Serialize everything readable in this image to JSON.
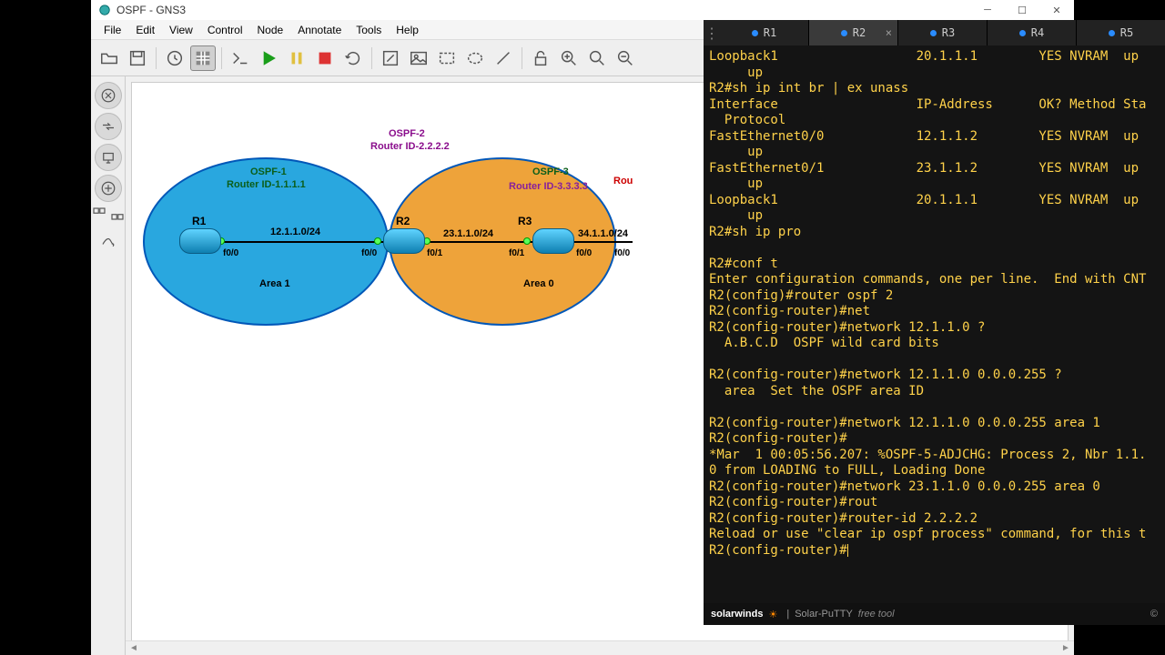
{
  "window": {
    "title": "OSPF - GNS3"
  },
  "menu": [
    "File",
    "Edit",
    "View",
    "Control",
    "Node",
    "Annotate",
    "Tools",
    "Help"
  ],
  "canvas": {
    "areas": [
      {
        "name": "Area 1",
        "ospf": "OSPF-1",
        "router_id": "Router ID-1.1.1.1",
        "ospf_color": "#0b5e1a",
        "id_color": "#0b5e1a"
      },
      {
        "name": "Area 0",
        "ospf": "OSPF-3",
        "router_id": "Router ID-3.3.3.3",
        "ospf_color": "#0b5e1a",
        "id_color": "#6e0b8c"
      }
    ],
    "center_ospf": "OSPF-2",
    "center_id": "Router ID-2.2.2.2",
    "routers": [
      "R1",
      "R2",
      "R3"
    ],
    "links": [
      "12.1.1.0/24",
      "23.1.1.0/24",
      "34.1.1.0/24"
    ],
    "ifs": [
      "f0/0",
      "f0/0",
      "f0/1",
      "f0/1",
      "f0/0",
      "f0/0"
    ],
    "rlabel_partial": "Rou"
  },
  "terminal": {
    "tabs": [
      "R1",
      "R2",
      "R3",
      "R4",
      "R5"
    ],
    "active": "R2",
    "lines": [
      "Loopback1                  20.1.1.1        YES NVRAM  up",
      "     up",
      "R2#sh ip int br | ex unass",
      "Interface                  IP-Address      OK? Method Sta",
      "  Protocol",
      "FastEthernet0/0            12.1.1.2        YES NVRAM  up",
      "     up",
      "FastEthernet0/1            23.1.1.2        YES NVRAM  up",
      "     up",
      "Loopback1                  20.1.1.1        YES NVRAM  up",
      "     up",
      "R2#sh ip pro",
      "",
      "R2#conf t",
      "Enter configuration commands, one per line.  End with CNT",
      "R2(config)#router ospf 2",
      "R2(config-router)#net",
      "R2(config-router)#network 12.1.1.0 ?",
      "  A.B.C.D  OSPF wild card bits",
      "",
      "R2(config-router)#network 12.1.1.0 0.0.0.255 ?",
      "  area  Set the OSPF area ID",
      "",
      "R2(config-router)#network 12.1.1.0 0.0.0.255 area 1",
      "R2(config-router)#",
      "*Mar  1 00:05:56.207: %OSPF-5-ADJCHG: Process 2, Nbr 1.1.",
      "0 from LOADING to FULL, Loading Done",
      "R2(config-router)#network 23.1.1.0 0.0.0.255 area 0",
      "R2(config-router)#rout",
      "R2(config-router)#router-id 2.2.2.2",
      "Reload or use \"clear ip ospf process\" command, for this t",
      "R2(config-router)#"
    ],
    "footer_brand": "solarwinds",
    "footer_app": "Solar-PuTTY",
    "footer_tag": "free tool",
    "footer_copy": "©"
  }
}
